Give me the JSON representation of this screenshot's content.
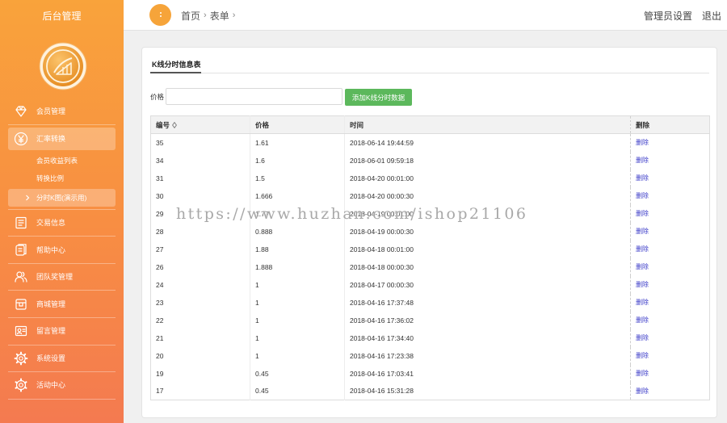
{
  "app": {
    "title": "后台管理"
  },
  "sidebar": {
    "items": [
      {
        "label": "会员管理",
        "icon": "gem-icon"
      },
      {
        "label": "汇率转换",
        "icon": "yen-icon",
        "selected": true,
        "children": [
          {
            "label": "会员收益列表"
          },
          {
            "label": "转换比例"
          },
          {
            "label": "分时K图(演示用)",
            "selected": true
          }
        ]
      },
      {
        "label": "交易信息",
        "icon": "document-icon"
      },
      {
        "label": "帮助中心",
        "icon": "book-icon"
      },
      {
        "label": "团队奖管理",
        "icon": "team-icon"
      },
      {
        "label": "商城管理",
        "icon": "store-icon"
      },
      {
        "label": "留言管理",
        "icon": "id-card-icon"
      },
      {
        "label": "系统设置",
        "icon": "gear-icon"
      },
      {
        "label": "活动中心",
        "icon": "activity-icon"
      }
    ]
  },
  "header": {
    "menu_toggle_icon": "menu-toggle-icon",
    "breadcrumb": [
      {
        "label": "首页"
      },
      {
        "label": "表单"
      }
    ],
    "separator": "›",
    "admin_settings": "管理员设置",
    "logout": "退出"
  },
  "card": {
    "title": "K线分时信息表",
    "form": {
      "price_label": "价格",
      "submit_label": "添加K线分时数据"
    },
    "table": {
      "headers": {
        "id": "编号",
        "price": "价格",
        "time": "时间",
        "action": "删除"
      },
      "rows": [
        {
          "id": "35",
          "price": "1.61",
          "time": "2018-06-14 19:44:59",
          "action": "删除"
        },
        {
          "id": "34",
          "price": "1.6",
          "time": "2018-06-01 09:59:18",
          "action": "删除"
        },
        {
          "id": "31",
          "price": "1.5",
          "time": "2018-04-20 00:01:00",
          "action": "删除"
        },
        {
          "id": "30",
          "price": "1.666",
          "time": "2018-04-20 00:00:30",
          "action": "删除"
        },
        {
          "id": "29",
          "price": "1.77",
          "time": "2018-04-19 00:01:00",
          "action": "删除"
        },
        {
          "id": "28",
          "price": "0.888",
          "time": "2018-04-19 00:00:30",
          "action": "删除"
        },
        {
          "id": "27",
          "price": "1.88",
          "time": "2018-04-18 00:01:00",
          "action": "删除"
        },
        {
          "id": "26",
          "price": "1.888",
          "time": "2018-04-18 00:00:30",
          "action": "删除"
        },
        {
          "id": "24",
          "price": "1",
          "time": "2018-04-17 00:00:30",
          "action": "删除"
        },
        {
          "id": "23",
          "price": "1",
          "time": "2018-04-16 17:37:48",
          "action": "删除"
        },
        {
          "id": "22",
          "price": "1",
          "time": "2018-04-16 17:36:02",
          "action": "删除"
        },
        {
          "id": "21",
          "price": "1",
          "time": "2018-04-16 17:34:40",
          "action": "删除"
        },
        {
          "id": "20",
          "price": "1",
          "time": "2018-04-16 17:23:38",
          "action": "删除"
        },
        {
          "id": "19",
          "price": "0.45",
          "time": "2018-04-16 17:03:41",
          "action": "删除"
        },
        {
          "id": "17",
          "price": "0.45",
          "time": "2018-04-16 15:31:28",
          "action": "删除"
        }
      ]
    }
  },
  "watermark": "https://www.huzhan.com/ishop21106",
  "colors": {
    "sidebar_top": "#f9a33b",
    "sidebar_bottom": "#f47a50",
    "accent": "#f6a43a",
    "button": "#5cb85c",
    "link": "#3a3ac8"
  }
}
